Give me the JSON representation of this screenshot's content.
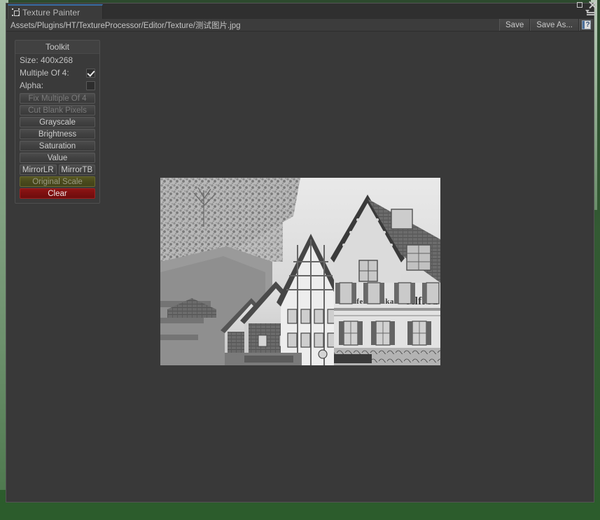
{
  "window": {
    "tab_title": "Texture Painter",
    "tab_icon": "texture-window-icon",
    "maximize_icon": "maximize-icon",
    "close_icon": "close-icon",
    "menu_icon": "window-menu-icon"
  },
  "toolbar": {
    "path": "Assets/Plugins/HT/TextureProcessor/Editor/Texture/测试图片.jpg",
    "path_placeholder": "Assets/...",
    "save_label": "Save",
    "save_as_label": "Save As...",
    "help_icon": "help-book-icon",
    "help_glyph": "?"
  },
  "toolkit": {
    "title": "Toolkit",
    "size_label": "Size: 400x268",
    "size_value": "400x268",
    "multiple_of_4_label": "Multiple Of 4:",
    "multiple_of_4_checked": true,
    "alpha_label": "Alpha:",
    "alpha_checked": false,
    "buttons": [
      {
        "label": "Fix Multiple Of 4",
        "state": "disabled",
        "style": "default"
      },
      {
        "label": "Cut Blank Pixels",
        "state": "disabled",
        "style": "default"
      },
      {
        "label": "Grayscale",
        "state": "enabled",
        "style": "default"
      },
      {
        "label": "Brightness",
        "state": "enabled",
        "style": "default"
      },
      {
        "label": "Saturation",
        "state": "enabled",
        "style": "default"
      },
      {
        "label": "Value",
        "state": "enabled",
        "style": "default"
      },
      {
        "label": "MirrorLR",
        "state": "enabled",
        "style": "default"
      },
      {
        "label": "MirrorTB",
        "state": "enabled",
        "style": "default"
      },
      {
        "label": "Original Scale",
        "state": "disabled",
        "style": "olive"
      },
      {
        "label": "Clear",
        "state": "enabled",
        "style": "red"
      }
    ]
  },
  "canvas": {
    "texture_name": "测试图片.jpg",
    "texture_width": 400,
    "texture_height": 268,
    "texture_description": "Grayscale photograph of German half-timbered houses on a hillside street",
    "sign_text_1": "Seifenfabrikation",
    "sign_text_2": "Alfred"
  },
  "colors": {
    "window_bg": "#393939",
    "panel_bg": "#3a3a3a",
    "tab_accent": "#3b6ea5",
    "clear_button": "#7c1010",
    "original_scale_button": "#4a4a1c",
    "editor_backdrop_green": "#335a33",
    "text_primary": "#c8c8c8",
    "text_disabled": "#7a7a7a"
  }
}
